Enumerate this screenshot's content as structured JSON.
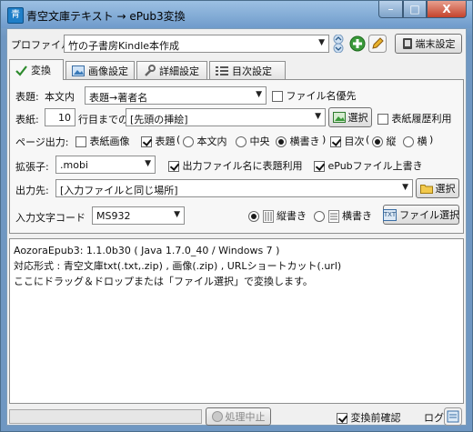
{
  "window": {
    "title": "青空文庫テキスト → ePub3変換",
    "app_icon_glyph": "青",
    "min_glyph": "–",
    "max_glyph": "□",
    "close_glyph": "X"
  },
  "profile": {
    "label": "プロファイル:",
    "selected": "竹の子書房Kindle本作成",
    "device_settings_label": "端末設定"
  },
  "tabs": [
    {
      "label": "変換",
      "active": true
    },
    {
      "label": "画像設定",
      "active": false
    },
    {
      "label": "詳細設定",
      "active": false
    },
    {
      "label": "目次設定",
      "active": false
    }
  ],
  "convert": {
    "title_label": "表題:",
    "title_source_label": "本文内",
    "title_format_selected": "表題→著者名",
    "filename_priority_label": "ファイル名優先",
    "filename_priority_checked": false,
    "cover_label": "表紙:",
    "cover_lines_value": "10",
    "cover_lines_label": "行目までの",
    "cover_selected": "[先頭の挿絵]",
    "select_label": "選択",
    "cover_history_label": "表紙履歴利用",
    "cover_history_checked": false,
    "page_output_label": "ページ出力:",
    "cover_image_label": "表紙画像",
    "cover_image_checked": false,
    "title_page_label": "表題",
    "title_page_checked": true,
    "title_page_options": [
      "本文内",
      "中央",
      "横書き"
    ],
    "title_page_selected": "横書き",
    "toc_label": "目次",
    "toc_checked": true,
    "toc_options": [
      "縦",
      "横"
    ],
    "toc_selected": "縦",
    "ext_label": "拡張子:",
    "ext_selected": ".mobi",
    "title_in_filename_label": "出力ファイル名に表題利用",
    "title_in_filename_checked": true,
    "overwrite_label": "ePubファイル上書き",
    "overwrite_checked": true,
    "output_label": "出力先:",
    "output_selected": "[入力ファイルと同じ場所]",
    "output_select_label": "選択",
    "encoding_label": "入力文字コード",
    "encoding_selected": "MS932",
    "vertical_label": "縦書き",
    "horizontal_label": "横書き",
    "writing_mode": "縦書き",
    "file_select_label": "ファイル選択",
    "txt_icon_text": "TXT"
  },
  "log": {
    "lines": [
      "AozoraEpub3: 1.1.0b30  ( Java 1.7.0_40  /  Windows 7 )",
      "対応形式 : 青空文庫txt(.txt,.zip) , 画像(.zip) , URLショートカット(.url)",
      "ここにドラッグ＆ドロップまたは「ファイル選択」で変換します。"
    ]
  },
  "status": {
    "abort_label": "処理中止",
    "preview_label": "変換前確認",
    "preview_checked": true,
    "log_label": "ログ:"
  },
  "colors": {
    "accent_green": "#3a9a3a",
    "title_bar": "#7ea6d0"
  }
}
